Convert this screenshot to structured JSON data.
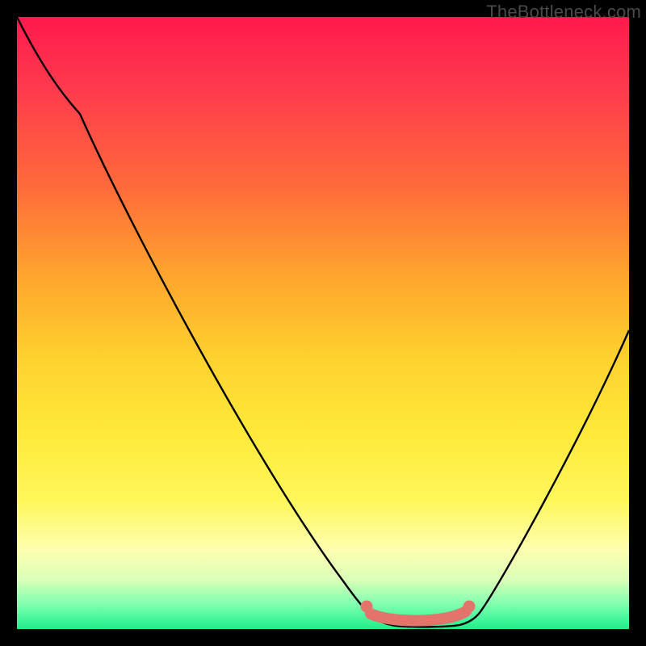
{
  "watermark": "TheBottleneck.com",
  "colors": {
    "frame": "#000000",
    "curve_stroke": "#000000",
    "marker_fill": "#e2746c",
    "marker_stroke": "#c9564e"
  },
  "chart_data": {
    "type": "line",
    "title": "",
    "xlabel": "",
    "ylabel": "",
    "xlim": [
      0,
      100
    ],
    "ylim": [
      0,
      100
    ],
    "grid": false,
    "axes_visible": false,
    "legend": false,
    "series": [
      {
        "name": "bottleneck-curve",
        "x": [
          0,
          5,
          10,
          15,
          20,
          25,
          30,
          35,
          40,
          45,
          50,
          55,
          57,
          60,
          63,
          66,
          68,
          71,
          73,
          76,
          80,
          85,
          90,
          95,
          100
        ],
        "y": [
          100,
          93,
          85,
          77,
          69,
          61,
          53,
          45,
          37,
          29,
          21,
          10,
          5,
          2,
          0.8,
          0.6,
          0.6,
          0.8,
          2.2,
          6.5,
          13,
          22,
          31,
          40,
          49
        ]
      }
    ],
    "markers": [
      {
        "name": "flat-region-start",
        "x": 57.3,
        "y": 4.3
      },
      {
        "name": "flat-region-end",
        "x": 73.2,
        "y": 4.3
      }
    ],
    "flat_segment": {
      "x_start": 57.3,
      "x_end": 73.2,
      "y": 2.8
    },
    "gradient_stops": [
      {
        "pct": 0,
        "color": "#ff1a4d"
      },
      {
        "pct": 12,
        "color": "#ff3b4d"
      },
      {
        "pct": 28,
        "color": "#ff6b3a"
      },
      {
        "pct": 42,
        "color": "#ffa42e"
      },
      {
        "pct": 56,
        "color": "#ffd22e"
      },
      {
        "pct": 68,
        "color": "#ffe93a"
      },
      {
        "pct": 79,
        "color": "#fff75a"
      },
      {
        "pct": 87,
        "color": "#fdffb0"
      },
      {
        "pct": 92,
        "color": "#d9ffb8"
      },
      {
        "pct": 96,
        "color": "#7fffb0"
      },
      {
        "pct": 100,
        "color": "#1cf08a"
      }
    ]
  }
}
